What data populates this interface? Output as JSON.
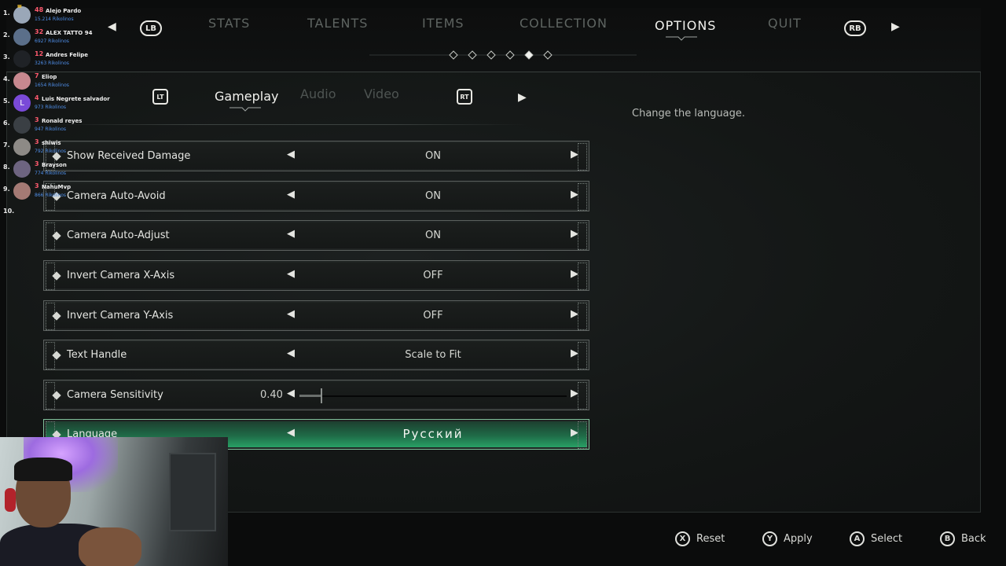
{
  "top_nav": {
    "lb": "LB",
    "rb": "RB",
    "tabs": [
      {
        "label": "STATS"
      },
      {
        "label": "TALENTS"
      },
      {
        "label": "ITEMS"
      },
      {
        "label": "COLLECTION"
      },
      {
        "label": "OPTIONS"
      },
      {
        "label": "QUIT"
      }
    ],
    "active_tab": "OPTIONS",
    "page_dots": 6,
    "active_dot": 5
  },
  "sub_nav": {
    "lt": "LT",
    "rt": "RT",
    "tabs": [
      {
        "label": "Gameplay"
      },
      {
        "label": "Audio"
      },
      {
        "label": "Video"
      }
    ],
    "active_tab": "Gameplay"
  },
  "description": "Change the language.",
  "settings": [
    {
      "label": "Show Received Damage",
      "value": "ON"
    },
    {
      "label": "Camera Auto-Avoid",
      "value": "ON"
    },
    {
      "label": "Camera Auto-Adjust",
      "value": "ON"
    },
    {
      "label": "Invert Camera X-Axis",
      "value": "OFF"
    },
    {
      "label": "Invert Camera Y-Axis",
      "value": "OFF"
    },
    {
      "label": "Text Handle",
      "value": "Scale to Fit"
    },
    {
      "label": "Camera Sensitivity",
      "value": "0.40",
      "slider_fraction": 0.08
    },
    {
      "label": "Language",
      "value": "Русский",
      "selected": true
    }
  ],
  "footer_hints": [
    {
      "button": "X",
      "label": "Reset"
    },
    {
      "button": "Y",
      "label": "Apply"
    },
    {
      "button": "A",
      "label": "Select"
    },
    {
      "button": "B",
      "label": "Back"
    }
  ],
  "leaderboard": [
    {
      "rank": "1.",
      "score": "48",
      "name": "Alejo Pardo",
      "sub": "15.214 Rikolinos"
    },
    {
      "rank": "2.",
      "score": "32",
      "name": "ALEX TATTO 94",
      "sub": "6927 Rikolinos"
    },
    {
      "rank": "3.",
      "score": "12",
      "name": "Andres Felipe",
      "sub": "3263 Rikolinos"
    },
    {
      "rank": "4.",
      "score": "7",
      "name": "Eliop",
      "sub": "1654 Rikolinos"
    },
    {
      "rank": "5.",
      "score": "4",
      "name": "Luis Negrete salvador",
      "sub": "973 Rikolinos",
      "initial": "L"
    },
    {
      "rank": "6.",
      "score": "3",
      "name": "Ronald reyes",
      "sub": "947 Rikolinos"
    },
    {
      "rank": "7.",
      "score": "3",
      "name": "shiwis",
      "sub": "792 Rikolinos"
    },
    {
      "rank": "8.",
      "score": "3",
      "name": "Brayson",
      "sub": "774 Rikolinos"
    },
    {
      "rank": "9.",
      "score": "3",
      "name": "NahuMvp",
      "sub": "866 Rikolinos"
    },
    {
      "rank": "10.",
      "score": "",
      "name": "",
      "sub": ""
    }
  ],
  "colors": {
    "accent_green": "#2aa86a",
    "score_red": "#ff5a6e",
    "sub_blue": "#4f8ee8"
  }
}
